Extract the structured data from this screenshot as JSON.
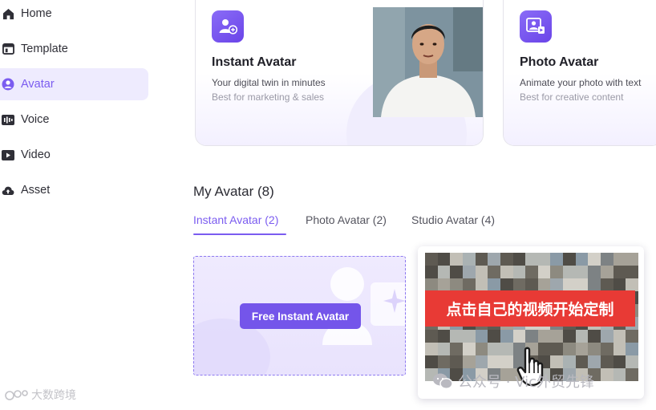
{
  "sidebar": {
    "items": [
      {
        "label": "Home",
        "icon": "home-icon",
        "active": false
      },
      {
        "label": "Template",
        "icon": "template-icon",
        "active": false
      },
      {
        "label": "Avatar",
        "icon": "avatar-icon",
        "active": true
      },
      {
        "label": "Voice",
        "icon": "voice-icon",
        "active": false
      },
      {
        "label": "Video",
        "icon": "video-icon",
        "active": false
      },
      {
        "label": "Asset",
        "icon": "cloud-upload-icon",
        "active": false
      }
    ]
  },
  "features": [
    {
      "title": "Instant Avatar",
      "desc": "Your digital twin in minutes",
      "sub": "Best for marketing & sales",
      "icon": "instant-avatar-icon"
    },
    {
      "title": "Photo Avatar",
      "desc": "Animate your photo with text",
      "sub": "Best for creative content",
      "icon": "photo-avatar-icon"
    }
  ],
  "my_avatar": {
    "title": "My Avatar (8)",
    "tabs": [
      {
        "label": "Instant Avatar (2)",
        "active": true
      },
      {
        "label": "Photo Avatar (2)",
        "active": false
      },
      {
        "label": "Studio Avatar (4)",
        "active": false
      }
    ],
    "create_button": "Free Instant Avatar",
    "video_overlay_text": "点击自己的视频开始定制"
  },
  "watermarks": {
    "card": "公众号 · Vic外贸先锋",
    "corner": "大数跨境"
  },
  "colors": {
    "accent": "#7B5CF0",
    "active_bg": "#EEEBFE",
    "banner_red": "#E83A35"
  }
}
